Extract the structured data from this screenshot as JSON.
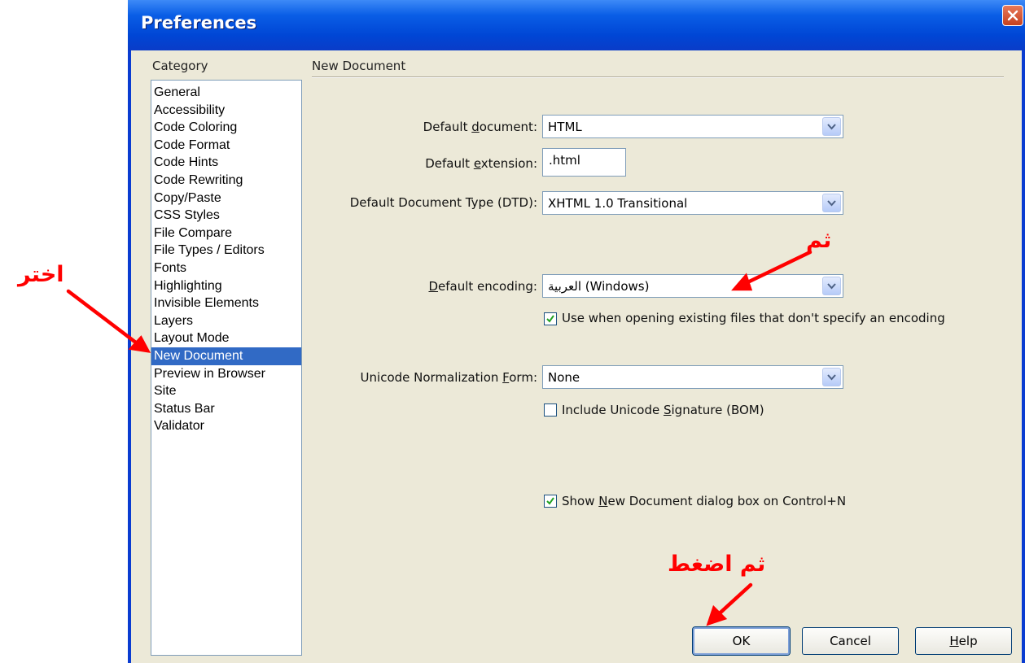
{
  "window": {
    "title": "Preferences"
  },
  "category": {
    "label": "Category",
    "items": [
      "General",
      "Accessibility",
      "Code Coloring",
      "Code Format",
      "Code Hints",
      "Code Rewriting",
      "Copy/Paste",
      "CSS Styles",
      "File Compare",
      "File Types / Editors",
      "Fonts",
      "Highlighting",
      "Invisible Elements",
      "Layers",
      "Layout Mode",
      "New Document",
      "Preview in Browser",
      "Site",
      "Status Bar",
      "Validator"
    ],
    "selected": "New Document"
  },
  "panel": {
    "title": "New Document",
    "default_document": {
      "label_pre": "Default ",
      "label_key": "d",
      "label_post": "ocument:",
      "value": "HTML"
    },
    "default_extension": {
      "label_pre": "Default ",
      "label_key": "e",
      "label_post": "xtension:",
      "value": ".html"
    },
    "default_dtd": {
      "label": "Default Document Type (DTD):",
      "value": "XHTML 1.0 Transitional"
    },
    "default_encoding": {
      "label_pre": "",
      "label_key": "D",
      "label_post": "efault encoding:",
      "value": "العربية (Windows)"
    },
    "use_when_opening": {
      "label": "Use when opening existing files that don't specify an encoding",
      "checked": true
    },
    "unicode_norm": {
      "label_pre": "Unicode Normalization ",
      "label_key": "F",
      "label_post": "orm:",
      "value": "None"
    },
    "include_bom": {
      "label_pre": "Include Unicode ",
      "label_key": "S",
      "label_post": "ignature (BOM)",
      "checked": false
    },
    "show_new_doc": {
      "label_pre": "Show ",
      "label_key": "N",
      "label_post": "ew Document dialog box on Control+N",
      "checked": true
    }
  },
  "buttons": {
    "ok": "OK",
    "cancel": "Cancel",
    "help_key": "H",
    "help_rest": "elp"
  },
  "annotations": {
    "choose": "اختر",
    "then": "ثم",
    "then_press": "ثم اضغط"
  },
  "colors": {
    "annotation": "#ff0000",
    "selection": "#316ac5",
    "titlebar": "#0a5ee6"
  }
}
